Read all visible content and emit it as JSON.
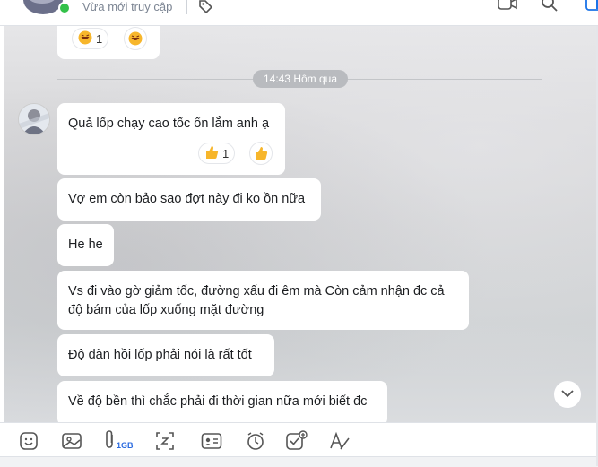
{
  "header": {
    "status": "Vừa mới truy cập"
  },
  "date_separator": "14:43 Hôm qua",
  "top_reaction": {
    "count": "1"
  },
  "messages": [
    {
      "text": "Quả lốp chạy cao tốc ổn lắm anh ạ",
      "reaction_count": "1"
    },
    {
      "text": "Vợ em còn bảo sao đợt này đi ko ồn nữa"
    },
    {
      "text": "He he"
    },
    {
      "line1": "Vs đi vào gờ giảm tốc, đường xấu đi êm mà Còn cảm nhận đc cả",
      "line2": "độ bám của lốp xuống mặt đường"
    },
    {
      "text": "Độ đàn hồi lốp phải nói là rất tốt"
    },
    {
      "text": "Về độ bền thì chắc phải đi thời gian nữa mới biết đc"
    }
  ],
  "toolbar": {
    "attachment_limit": "1GB",
    "icons": [
      "sticker-icon",
      "image-icon",
      "attach-icon",
      "screenshot-icon",
      "contact-card-icon",
      "reminder-icon",
      "task-icon",
      "format-text-icon"
    ]
  },
  "colors": {
    "accent": "#2b6be0",
    "online": "#33c14a",
    "bubble": "#ffffff"
  }
}
